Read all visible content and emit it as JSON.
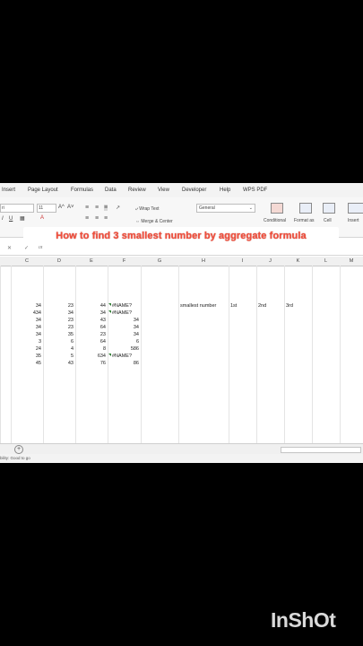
{
  "ribbon": {
    "tabs": [
      "Insert",
      "Page Layout",
      "Formulas",
      "Data",
      "Review",
      "View",
      "Developer",
      "Help",
      "WPS PDF"
    ],
    "font_name": "ri",
    "font_size": "11",
    "grow_font": "A^",
    "shrink_font": "A˅",
    "bold": "I",
    "underline": "U",
    "wrap_text": "Wrap Text",
    "merge_center": "Merge & Center",
    "number_format": "General",
    "conditional": "Conditional",
    "format_as": "Format as",
    "cell": "Cell",
    "insert": "Insert"
  },
  "banner": {
    "text": "How to find 3 smallest number by aggregate formula"
  },
  "formula_bar": {
    "cancel": "✕",
    "confirm": "✓",
    "fx": "fx",
    "value": ""
  },
  "columns": [
    "C",
    "D",
    "E",
    "F",
    "G",
    "H",
    "I",
    "J",
    "K",
    "L",
    "M"
  ],
  "rows": [
    [
      "34",
      "23",
      "44",
      "#NAME?"
    ],
    [
      "434",
      "34",
      "34",
      "#NAME?"
    ],
    [
      "34",
      "23",
      "43",
      "34"
    ],
    [
      "34",
      "23",
      "64",
      "34"
    ],
    [
      "34",
      "35",
      "23",
      "34"
    ],
    [
      "3",
      "6",
      "64",
      "6"
    ],
    [
      "24",
      "4",
      "8",
      "586"
    ],
    [
      "35",
      "5",
      "634",
      "#NAME?"
    ],
    [
      "45",
      "43",
      "76",
      "86"
    ]
  ],
  "labels": {
    "h": "smallest number",
    "i": "1st",
    "j": "2nd",
    "k": "3rd"
  },
  "status": {
    "text": "bility: Good to go"
  },
  "sheet": {
    "add": "+"
  },
  "watermark": {
    "text": "InShOt"
  },
  "colors": {
    "banner_text": "#f24e3c",
    "error_marker": "#2e7d32",
    "background": "#000000"
  }
}
